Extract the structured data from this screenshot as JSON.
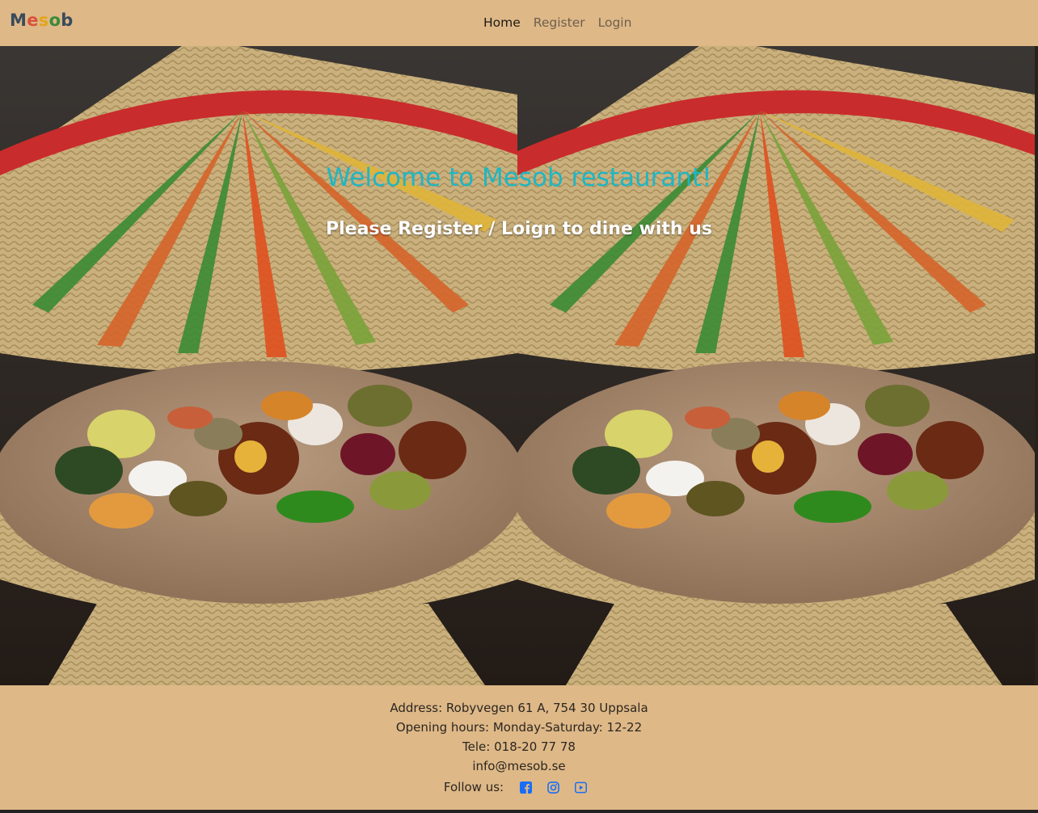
{
  "brand": {
    "letters": [
      {
        "ch": "M",
        "color": "#3a4b5c"
      },
      {
        "ch": "e",
        "color": "#d9533a"
      },
      {
        "ch": "s",
        "color": "#e3a51b"
      },
      {
        "ch": "o",
        "color": "#3a8a3a"
      },
      {
        "ch": "b",
        "color": "#3a4b5c"
      }
    ]
  },
  "nav": {
    "items": [
      {
        "label": "Home",
        "active": true
      },
      {
        "label": "Register",
        "active": false
      },
      {
        "label": "Login",
        "active": false
      }
    ]
  },
  "hero": {
    "title": "Welcome to Mesob restaurant!",
    "subtitle": "Please Register / Loign to dine with us",
    "title_color": "#1fb6c4"
  },
  "footer": {
    "address": "Address: Robyvegen 61 A, 754 30 Uppsala",
    "hours": "Opening hours: Monday-Saturday: 12-22",
    "phone": "Tele: 018-20 77 78",
    "email": "info@mesob.se",
    "follow_label": "Follow us:",
    "social": [
      "facebook-icon",
      "instagram-icon",
      "youtube-icon"
    ],
    "social_color": "#1a6ef5"
  }
}
